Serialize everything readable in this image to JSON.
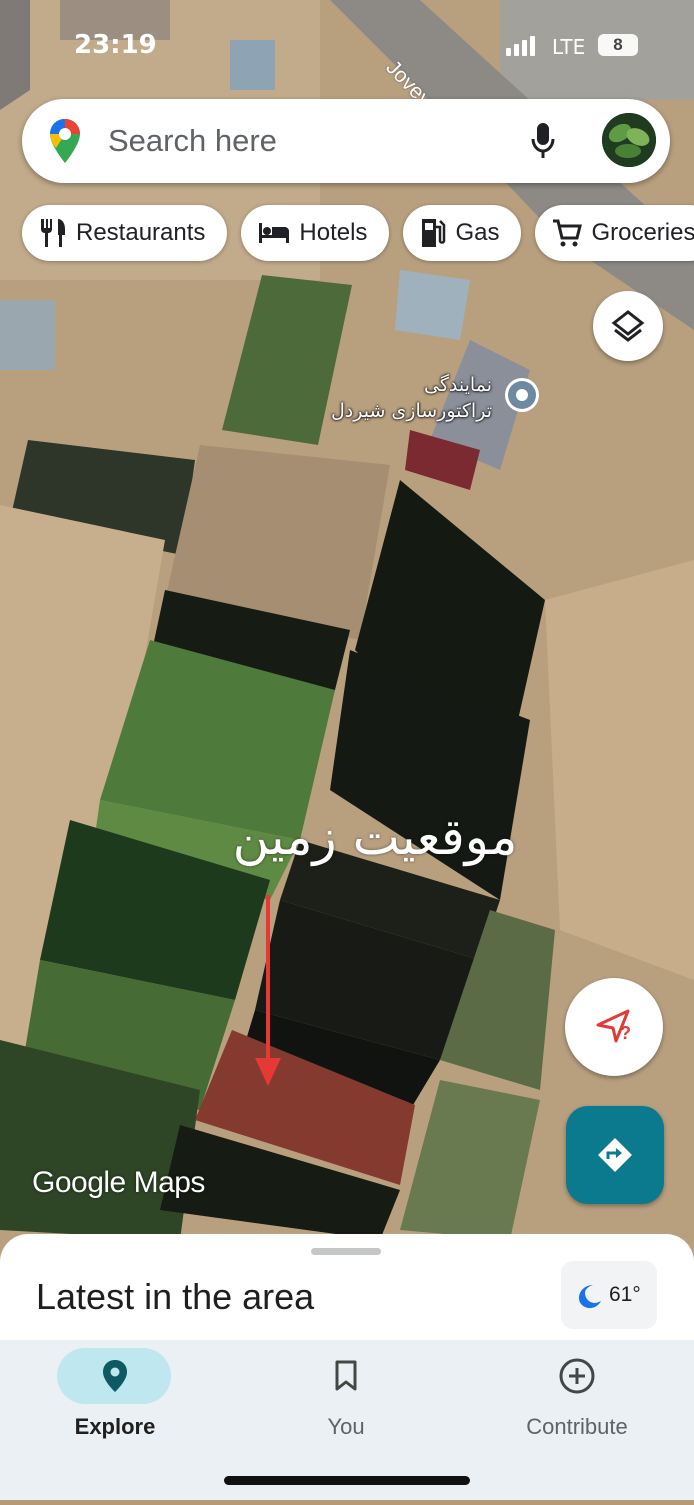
{
  "status_bar": {
    "time": "23:19",
    "network": "LTE",
    "battery": "8"
  },
  "search": {
    "placeholder": "Search here"
  },
  "chips": [
    {
      "label": "Restaurants",
      "icon": "fork-knife-icon"
    },
    {
      "label": "Hotels",
      "icon": "bed-icon"
    },
    {
      "label": "Gas",
      "icon": "gas-pump-icon"
    },
    {
      "label": "Groceries",
      "icon": "shopping-cart-icon"
    }
  ],
  "map": {
    "road_label": "Joveyn",
    "place_label_line1": "نمایندگی",
    "place_label_line2": "تراکتورسازی شیردل",
    "annotation": "موقعیت زمین",
    "watermark": "Google Maps",
    "arrow_color": "#e53935"
  },
  "sheet": {
    "title": "Latest in the area",
    "temperature": "61°",
    "weather_icon": "moon-icon"
  },
  "nav": [
    {
      "label": "Explore",
      "icon": "location-pin-icon",
      "active": true
    },
    {
      "label": "You",
      "icon": "bookmark-icon",
      "active": false
    },
    {
      "label": "Contribute",
      "icon": "plus-circle-icon",
      "active": false
    }
  ],
  "colors": {
    "accent": "#0b7a8f",
    "active_pill": "#bfe7ef",
    "nav_bg": "#eaf0f4"
  }
}
